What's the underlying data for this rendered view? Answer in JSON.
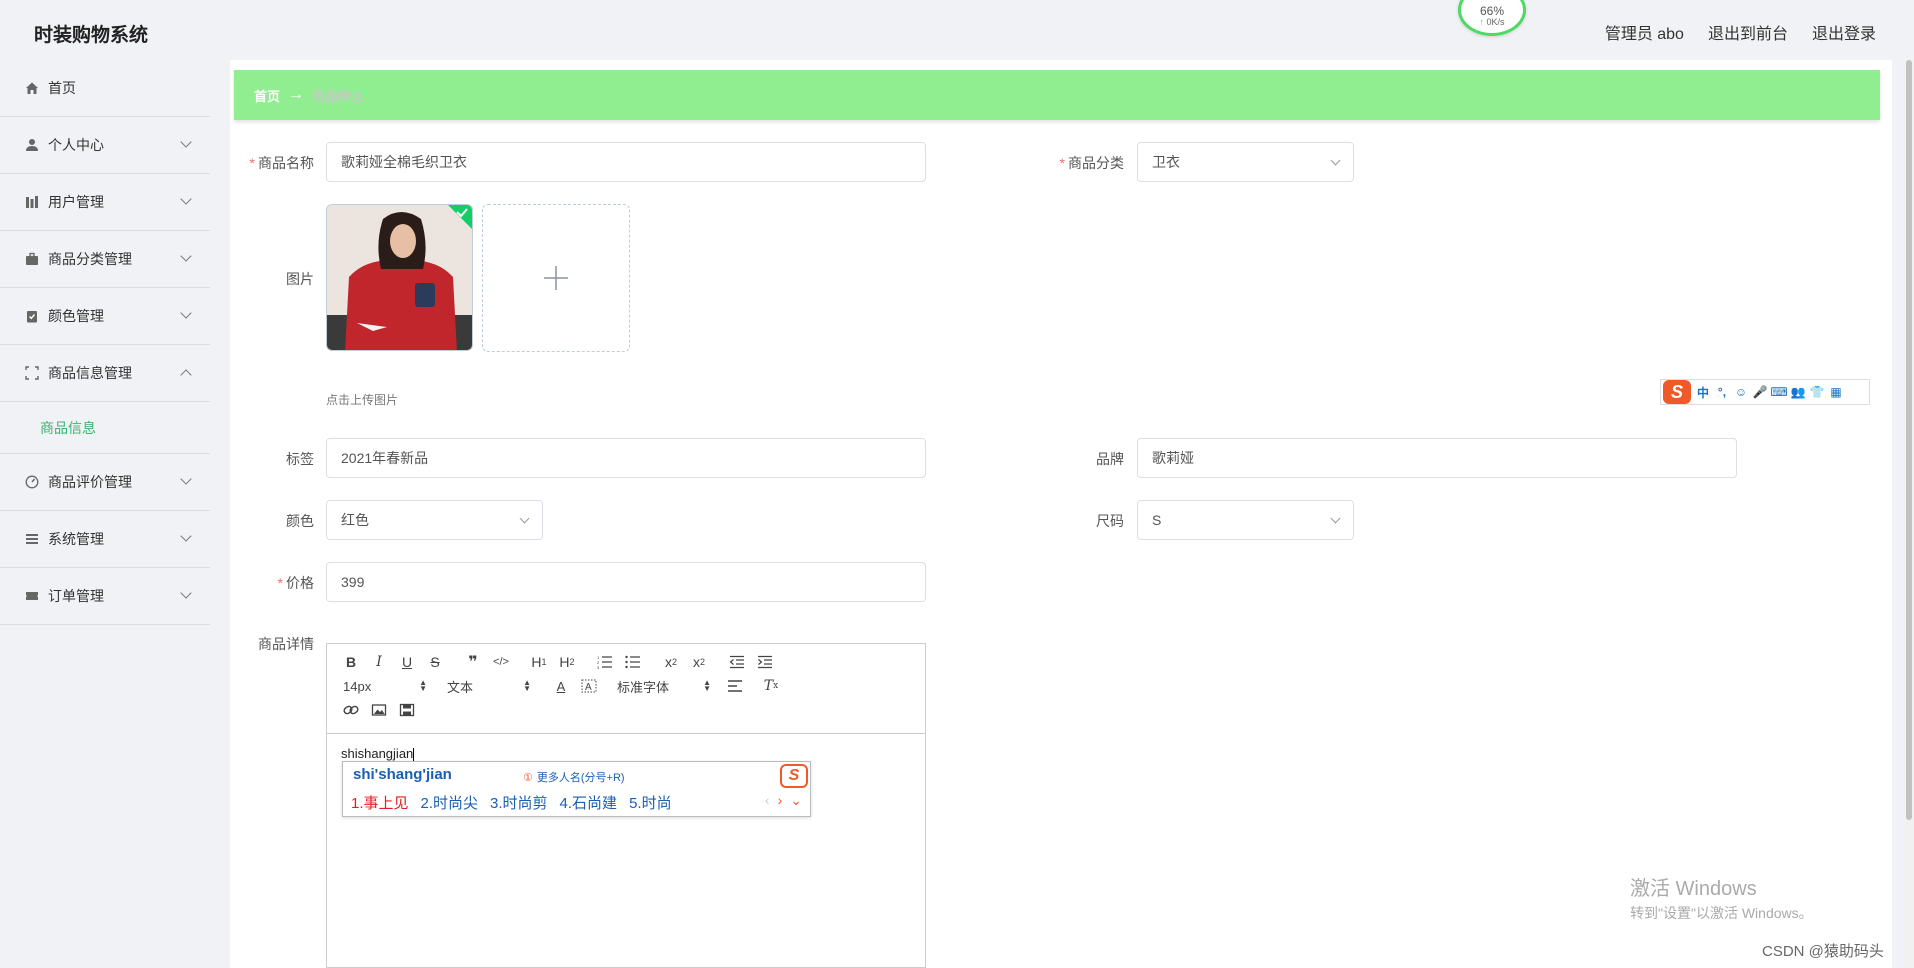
{
  "app": {
    "title": "时装购物系统"
  },
  "header": {
    "speed": {
      "percent": "66%",
      "rate": "0K/s"
    },
    "links": [
      "管理员 abo",
      "退出到前台",
      "退出登录"
    ]
  },
  "sidebar": {
    "items": [
      {
        "label": "首页",
        "icon": "home-icon"
      },
      {
        "label": "个人中心",
        "icon": "user-icon"
      },
      {
        "label": "用户管理",
        "icon": "chart-bars-icon"
      },
      {
        "label": "商品分类管理",
        "icon": "briefcase-icon"
      },
      {
        "label": "颜色管理",
        "icon": "clipboard-check-icon"
      },
      {
        "label": "商品信息管理",
        "icon": "frame-icon",
        "expanded": true
      },
      {
        "label": "商品评价管理",
        "icon": "dashboard-icon"
      },
      {
        "label": "系统管理",
        "icon": "menu-lines-icon"
      },
      {
        "label": "订单管理",
        "icon": "ticket-icon"
      }
    ],
    "submenu": {
      "label": "商品信息"
    }
  },
  "breadcrumb": {
    "home": "首页",
    "arrow": "→",
    "current": "商品信息"
  },
  "form": {
    "name": {
      "label": "商品名称",
      "value": "歌莉娅全棉毛织卫衣"
    },
    "category": {
      "label": "商品分类",
      "value": "卫衣"
    },
    "image": {
      "label": "图片",
      "tip": "点击上传图片"
    },
    "tag": {
      "label": "标签",
      "value": "2021年春新品"
    },
    "brand": {
      "label": "品牌",
      "value": "歌莉娅"
    },
    "color": {
      "label": "颜色",
      "value": "红色"
    },
    "size": {
      "label": "尺码",
      "value": "S"
    },
    "price": {
      "label": "价格",
      "value": "399"
    },
    "detail": {
      "label": "商品详情"
    }
  },
  "editor": {
    "font_size": "14px",
    "header_picker": "文本",
    "font_family": "标准字体",
    "content": "shishangjian"
  },
  "ime": {
    "toolbar": [
      "中",
      "°,",
      "☺",
      "🎤",
      "⌨",
      "👥",
      "👕",
      "▦"
    ],
    "pinyin": "shi'shang'jian",
    "hint_num": "①",
    "hint": "更多人名(分号+R)",
    "candidates": [
      "1.事上见",
      "2.时尚尖",
      "3.时尚剪",
      "4.石尚建",
      "5.时尚"
    ]
  },
  "watermark": {
    "line1": "激活 Windows",
    "line2": "转到\"设置\"以激活 Windows。"
  },
  "credit": "CSDN @猿助码头",
  "colors": {
    "breadcrumb_bg": "#90ee90",
    "active_menu": "#3cb371",
    "required": "#f56c6c"
  }
}
